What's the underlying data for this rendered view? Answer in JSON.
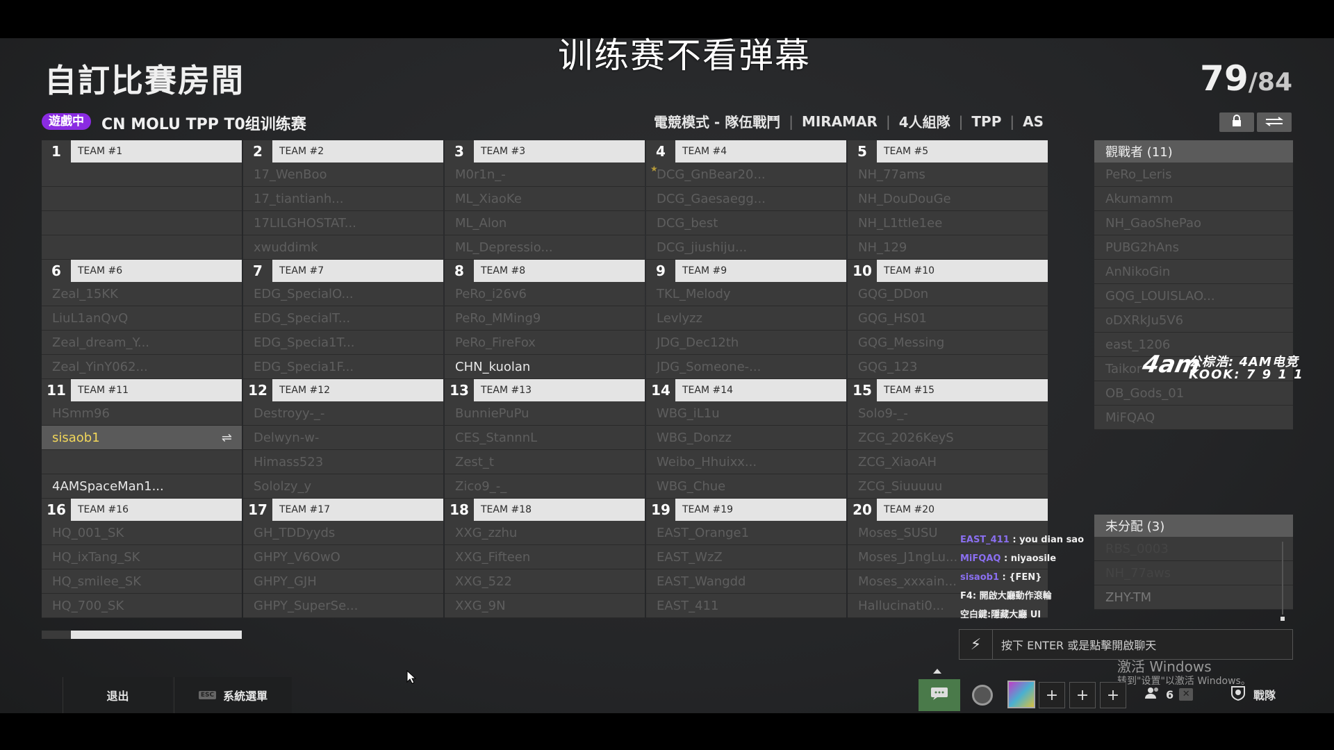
{
  "overlay_text": "训练赛不看弹幕",
  "page_title": "自訂比賽房間",
  "player_count": {
    "current": "79",
    "total": "/84"
  },
  "room": {
    "status_badge": "遊戲中",
    "name": "CN MOLU TPP T0组训练赛"
  },
  "settings": {
    "mode": "電競模式 - 隊伍戰鬥",
    "map": "MIRAMAR",
    "squad": "4人組隊",
    "perspective": "TPP",
    "region": "AS"
  },
  "teams": [
    {
      "num": "1",
      "label": "TEAM #1",
      "players": [
        "",
        "",
        "",
        ""
      ]
    },
    {
      "num": "2",
      "label": "TEAM #2",
      "players": [
        "17_WenBoo",
        "17_tiantianh...",
        "17LILGHOSTAT...",
        "xwuddimk"
      ]
    },
    {
      "num": "3",
      "label": "TEAM #3",
      "players": [
        "M0r1n_-",
        "ML_XiaoKe",
        "ML_Alon",
        "ML_Depressio..."
      ]
    },
    {
      "num": "4",
      "label": "TEAM #4",
      "players": [
        "DCG_GnBear20...",
        "DCG_Gaesaegg...",
        "DCG_best",
        "DCG_jiushiju..."
      ]
    },
    {
      "num": "5",
      "label": "TEAM #5",
      "players": [
        "NH_77ams",
        "NH_DouDouGe",
        "NH_L1ttle1ee",
        "NH_129"
      ]
    },
    {
      "num": "6",
      "label": "TEAM #6",
      "players": [
        "Zeal_15KK",
        "LiuL1anQvQ",
        "Zeal_dream_Y...",
        "Zeal_YinY062..."
      ]
    },
    {
      "num": "7",
      "label": "TEAM #7",
      "players": [
        "EDG_SpecialO...",
        "EDG_SpecialT...",
        "EDG_Specia1T...",
        "EDG_Specia1F..."
      ]
    },
    {
      "num": "8",
      "label": "TEAM #8",
      "players": [
        "PeRo_i26v6",
        "PeRo_MMing9",
        "PeRo_FireFox",
        "CHN_kuolan"
      ]
    },
    {
      "num": "9",
      "label": "TEAM #9",
      "players": [
        "TKL_Melody",
        "Levlyzz",
        "JDG_Dec12th",
        "JDG_Someone-..."
      ]
    },
    {
      "num": "10",
      "label": "TEAM #10",
      "players": [
        "GQG_DDon",
        "GQG_HS01",
        "GQG_Messing",
        "GQG_123"
      ]
    },
    {
      "num": "11",
      "label": "TEAM #11",
      "players": [
        "HSmm96",
        "sisaob1",
        "",
        "4AMSpaceMan1..."
      ]
    },
    {
      "num": "12",
      "label": "TEAM #12",
      "players": [
        "Destroyy-_-",
        "Delwyn-w-",
        "Himass523",
        "Sololzy_y"
      ]
    },
    {
      "num": "13",
      "label": "TEAM #13",
      "players": [
        "BunniePuPu",
        "CES_StannnL",
        "Zest_t",
        "Zico9_-_"
      ]
    },
    {
      "num": "14",
      "label": "TEAM #14",
      "players": [
        "WBG_iL1u",
        "WBG_Donzz",
        "Weibo_Hhuixx...",
        "WBG_Chue"
      ]
    },
    {
      "num": "15",
      "label": "TEAM #15",
      "players": [
        "Solo9-_-",
        "ZCG_2026KeyS",
        "ZCG_XiaoAH",
        "ZCG_Siuuuuu"
      ]
    },
    {
      "num": "16",
      "label": "TEAM #16",
      "players": [
        "HQ_001_SK",
        "HQ_ixTang_SK",
        "HQ_smilee_SK",
        "HQ_700_SK"
      ]
    },
    {
      "num": "17",
      "label": "TEAM #17",
      "players": [
        "GH_TDDyyds",
        "GHPY_V6OwO",
        "GHPY_GJH",
        "GHPY_SuperSe..."
      ]
    },
    {
      "num": "18",
      "label": "TEAM #18",
      "players": [
        "XXG_zzhu",
        "XXG_Fifteen",
        "XXG_522",
        "XXG_9N"
      ]
    },
    {
      "num": "19",
      "label": "TEAM #19",
      "players": [
        "EAST_Orange1",
        "EAST_WzZ",
        "EAST_Wangdd",
        "EAST_411"
      ]
    },
    {
      "num": "20",
      "label": "TEAM #20",
      "players": [
        "Moses_SUSU",
        "Moses_J1ngLu...",
        "Moses_xxxain...",
        "Hallucinati0..."
      ]
    }
  ],
  "spectators": {
    "title": "觀戰者 (11)",
    "list": [
      "PeRo_Leris",
      "Akumamm",
      "NH_GaoShePao",
      "PUBG2hAns",
      "AnNikoGin",
      "GQG_LOUISLAO...",
      "oDXRkJu5V6",
      "east_1206",
      "Taikor",
      "OB_Gods_01",
      "MiFQAQ"
    ]
  },
  "unassigned": {
    "title": "未分配 (3)",
    "list": [
      "RBS_0003",
      "NH_77aws",
      "ZHY-TM"
    ]
  },
  "watermark": {
    "logo": "4am",
    "line1": "公棕浩: 4AM电竞",
    "line2": "KOOK: 7 9 1 1"
  },
  "chat": {
    "messages": [
      {
        "user": "EAST_411",
        "text": " : you dian sao"
      },
      {
        "user": "MiFQAQ",
        "text": " : niyaosile"
      },
      {
        "user": "sisaob1",
        "text": " : {FEN}"
      }
    ],
    "hints": [
      "F4: 開啟大廳動作滾輪",
      "空白鍵:隱藏大廳 UI"
    ],
    "input_placeholder": "按下 ENTER 或是點擊開啟聊天"
  },
  "windows_activation": {
    "line1": "激活 Windows",
    "line2": "转到\"设置\"以激活 Windows。"
  },
  "bottom": {
    "exit_label": "退出",
    "menu_key": "ESC",
    "menu_label": "系統選單",
    "squad_count": "6",
    "battle_label": "戰隊"
  }
}
